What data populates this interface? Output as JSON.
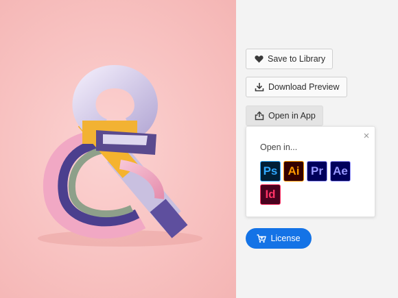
{
  "actions": {
    "save_to_library": "Save to Library",
    "download_preview": "Download Preview",
    "open_in_app": "Open in App"
  },
  "popover": {
    "title": "Open in...",
    "apps": [
      {
        "name": "Photoshop",
        "abbr": "Ps",
        "bg": "#001e36",
        "fg": "#31a8ff"
      },
      {
        "name": "Illustrator",
        "abbr": "Ai",
        "bg": "#330000",
        "fg": "#ff9a00"
      },
      {
        "name": "Premiere Pro",
        "abbr": "Pr",
        "bg": "#00005b",
        "fg": "#9999ff"
      },
      {
        "name": "After Effects",
        "abbr": "Ae",
        "bg": "#00005b",
        "fg": "#9999ff"
      },
      {
        "name": "InDesign",
        "abbr": "Id",
        "bg": "#49021f",
        "fg": "#ff3366"
      }
    ]
  },
  "license": {
    "label": "License"
  },
  "colors": {
    "accent": "#1473e6",
    "image_background": "#f8c2c1"
  },
  "icons": [
    "heart-icon",
    "download-icon",
    "share-icon",
    "close-icon",
    "cart-icon"
  ]
}
